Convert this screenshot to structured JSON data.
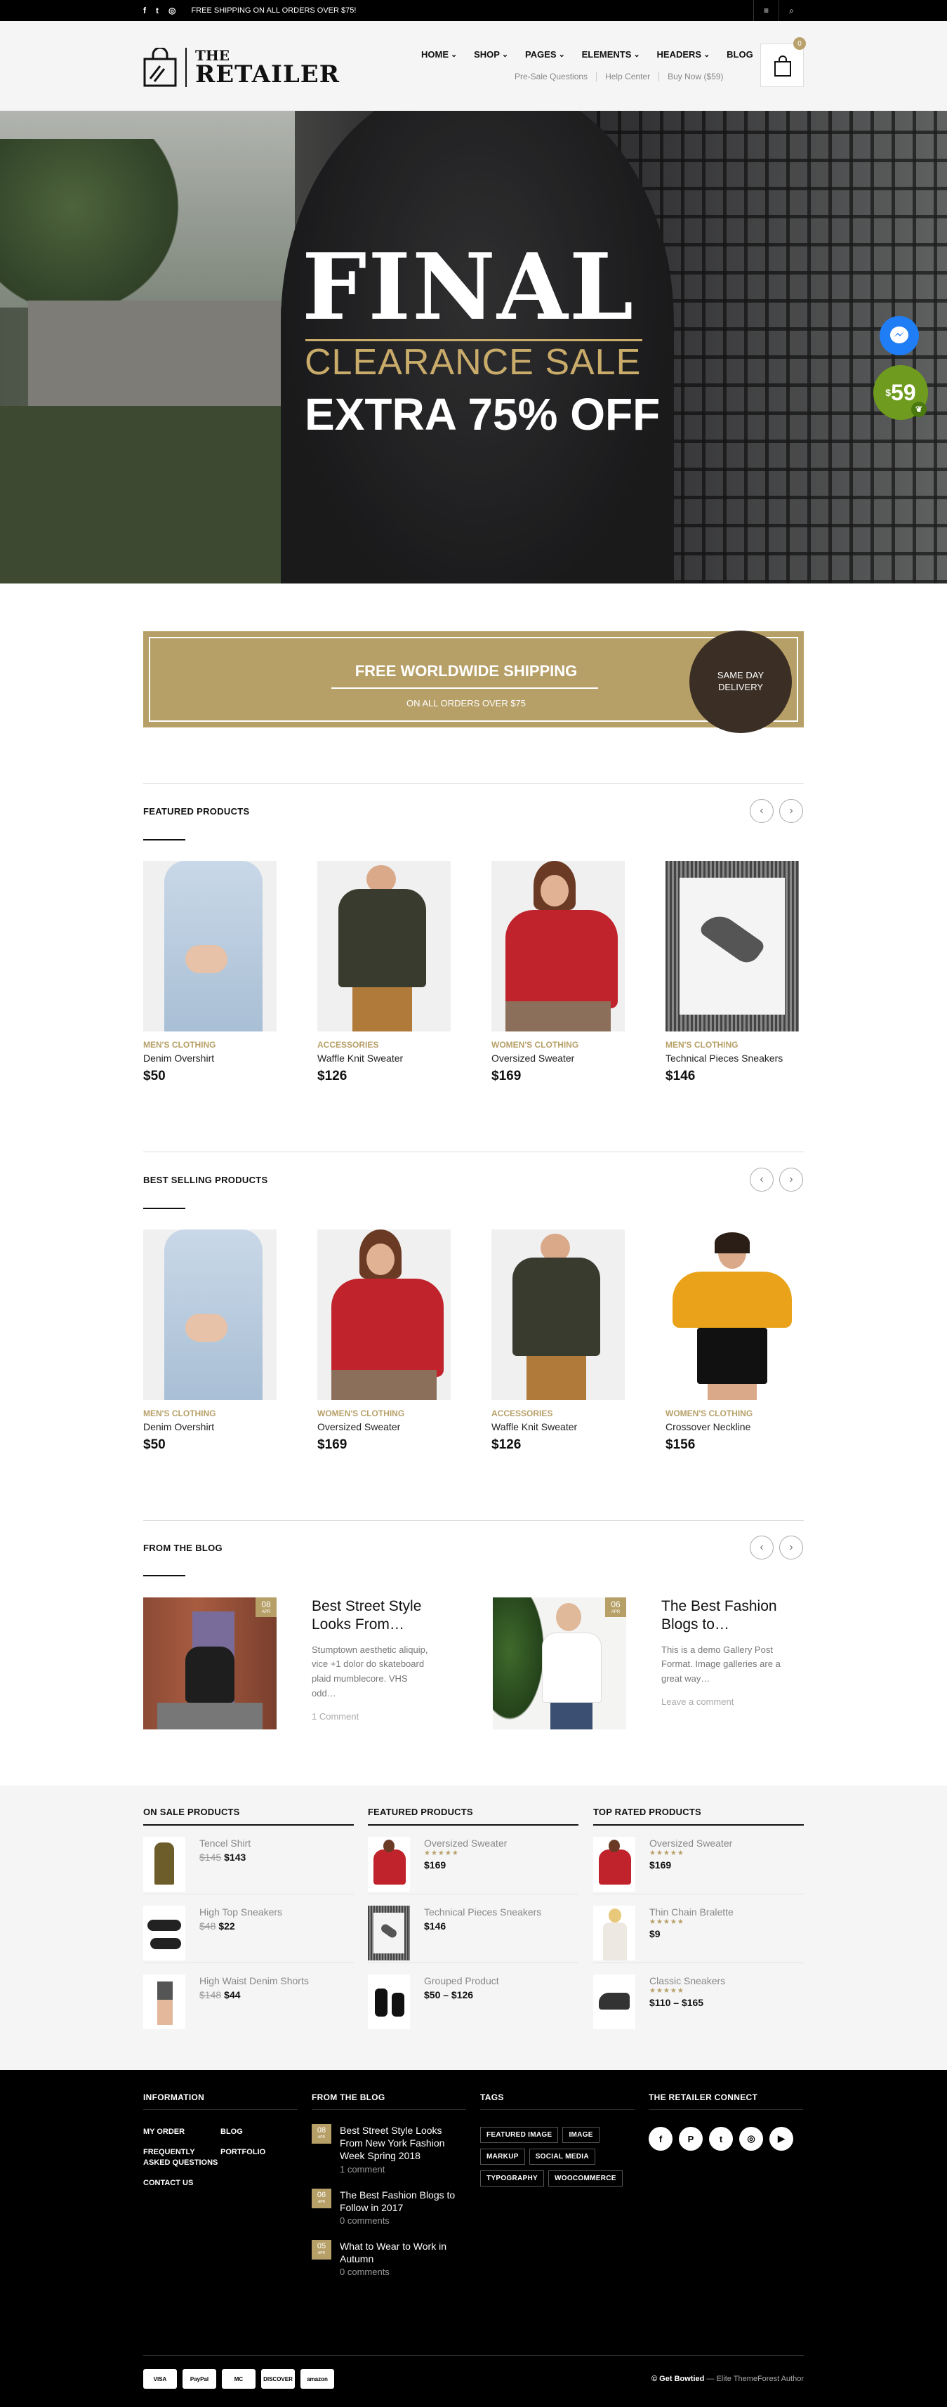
{
  "topbar": {
    "social": [
      "f",
      "t",
      "◎"
    ],
    "promo": "FREE SHIPPING ON ALL ORDERS OVER $75!",
    "menu_icon": "≡",
    "search_icon": "⌕"
  },
  "header": {
    "logo_top": "THE",
    "logo_bottom": "RETAILER",
    "nav": [
      "HOME",
      "SHOP",
      "PAGES",
      "ELEMENTS",
      "HEADERS",
      "BLOG"
    ],
    "subnav": [
      "Pre-Sale Questions",
      "Help Center",
      "Buy Now ($59)"
    ],
    "cart_count": "0"
  },
  "hero": {
    "final": "FINAL",
    "clearance": "CLEARANCE SALE",
    "extra": "EXTRA 75% OFF",
    "price_badge_currency": "$",
    "price_badge_value": "59"
  },
  "shipping_banner": {
    "title": "FREE WORLDWIDE SHIPPING",
    "subtitle": "ON ALL ORDERS OVER $75",
    "badge_line1": "SAME DAY",
    "badge_line2": "DELIVERY"
  },
  "featured": {
    "title": "FEATURED PRODUCTS",
    "prev": "‹",
    "next": "›",
    "items": [
      {
        "category": "MEN'S CLOTHING",
        "name": "Denim Overshirt",
        "price": "$50"
      },
      {
        "category": "ACCESSORIES",
        "name": "Waffle Knit Sweater",
        "price": "$126"
      },
      {
        "category": "WOMEN'S CLOTHING",
        "name": "Oversized Sweater",
        "price": "$169"
      },
      {
        "category": "MEN'S CLOTHING",
        "name": "Technical Pieces Sneakers",
        "price": "$146"
      }
    ]
  },
  "best": {
    "title": "BEST SELLING PRODUCTS",
    "prev": "‹",
    "next": "›",
    "items": [
      {
        "category": "MEN'S CLOTHING",
        "name": "Denim Overshirt",
        "price": "$50"
      },
      {
        "category": "WOMEN'S CLOTHING",
        "name": "Oversized Sweater",
        "price": "$169"
      },
      {
        "category": "ACCESSORIES",
        "name": "Waffle Knit Sweater",
        "price": "$126"
      },
      {
        "category": "WOMEN'S CLOTHING",
        "name": "Crossover Neckline",
        "price": "$156"
      }
    ]
  },
  "blog": {
    "title": "FROM THE BLOG",
    "prev": "‹",
    "next": "›",
    "posts": [
      {
        "day": "08",
        "month": "APR",
        "title": "Best Street Style Looks From…",
        "excerpt": "Stumptown aesthetic aliquip, vice +1 dolor do skateboard plaid mumblecore. VHS odd…",
        "comments": "1 Comment"
      },
      {
        "day": "06",
        "month": "APR",
        "title": "The Best Fashion Blogs to…",
        "excerpt": "This is a demo Gallery Post Format. Image galleries are a great way…",
        "comments": "Leave a comment"
      }
    ]
  },
  "widgets": {
    "on_sale": {
      "title": "ON SALE PRODUCTS",
      "items": [
        {
          "name": "Tencel Shirt",
          "old": "$145",
          "price": "$143"
        },
        {
          "name": "High Top Sneakers",
          "old": "$48",
          "price": "$22"
        },
        {
          "name": "High Waist Denim Shorts",
          "old": "$148",
          "price": "$44"
        }
      ]
    },
    "featured": {
      "title": "FEATURED PRODUCTS",
      "items": [
        {
          "name": "Oversized Sweater",
          "stars": "★★★★★",
          "price": "$169"
        },
        {
          "name": "Technical Pieces Sneakers",
          "stars": "",
          "price": "$146"
        },
        {
          "name": "Grouped Product",
          "stars": "",
          "price": "$50 – $126"
        }
      ]
    },
    "top_rated": {
      "title": "TOP RATED PRODUCTS",
      "items": [
        {
          "name": "Oversized Sweater",
          "stars": "★★★★★",
          "price": "$169"
        },
        {
          "name": "Thin Chain Bralette",
          "stars": "★★★★★",
          "price": "$9"
        },
        {
          "name": "Classic Sneakers",
          "stars": "★★★★★",
          "price": "$110 – $165"
        }
      ]
    }
  },
  "footer": {
    "info_title": "INFORMATION",
    "info_links": [
      "MY ORDER",
      "BLOG",
      "FREQUENTLY ASKED QUESTIONS",
      "PORTFOLIO",
      "CONTACT US"
    ],
    "blog_title": "FROM THE BLOG",
    "blog_posts": [
      {
        "day": "08",
        "month": "APR",
        "title": "Best Street Style Looks From New York Fashion Week Spring 2018",
        "comments": "1 comment"
      },
      {
        "day": "06",
        "month": "APR",
        "title": "The Best Fashion Blogs to Follow in 2017",
        "comments": "0 comments"
      },
      {
        "day": "05",
        "month": "APR",
        "title": "What to Wear to Work in Autumn",
        "comments": "0 comments"
      }
    ],
    "tags_title": "TAGS",
    "tags": [
      "FEATURED IMAGE",
      "IMAGE",
      "MARKUP",
      "SOCIAL MEDIA",
      "TYPOGRAPHY",
      "WOOCOMMERCE"
    ],
    "connect_title": "THE RETAILER CONNECT",
    "connect_icons": [
      "f",
      "P",
      "t",
      "◎",
      "▶"
    ],
    "payments": [
      "VISA",
      "PayPal",
      "MC",
      "DISCOVER",
      "amazon"
    ],
    "copyright_brand": "© Get Bowtied",
    "copyright_rest": " — Elite ThemeForest Author"
  },
  "colors": {
    "accent": "#b7a068",
    "dark_badge": "#3a2e25",
    "messenger": "#1f7ef5",
    "price_badge": "#6f9c1e"
  }
}
